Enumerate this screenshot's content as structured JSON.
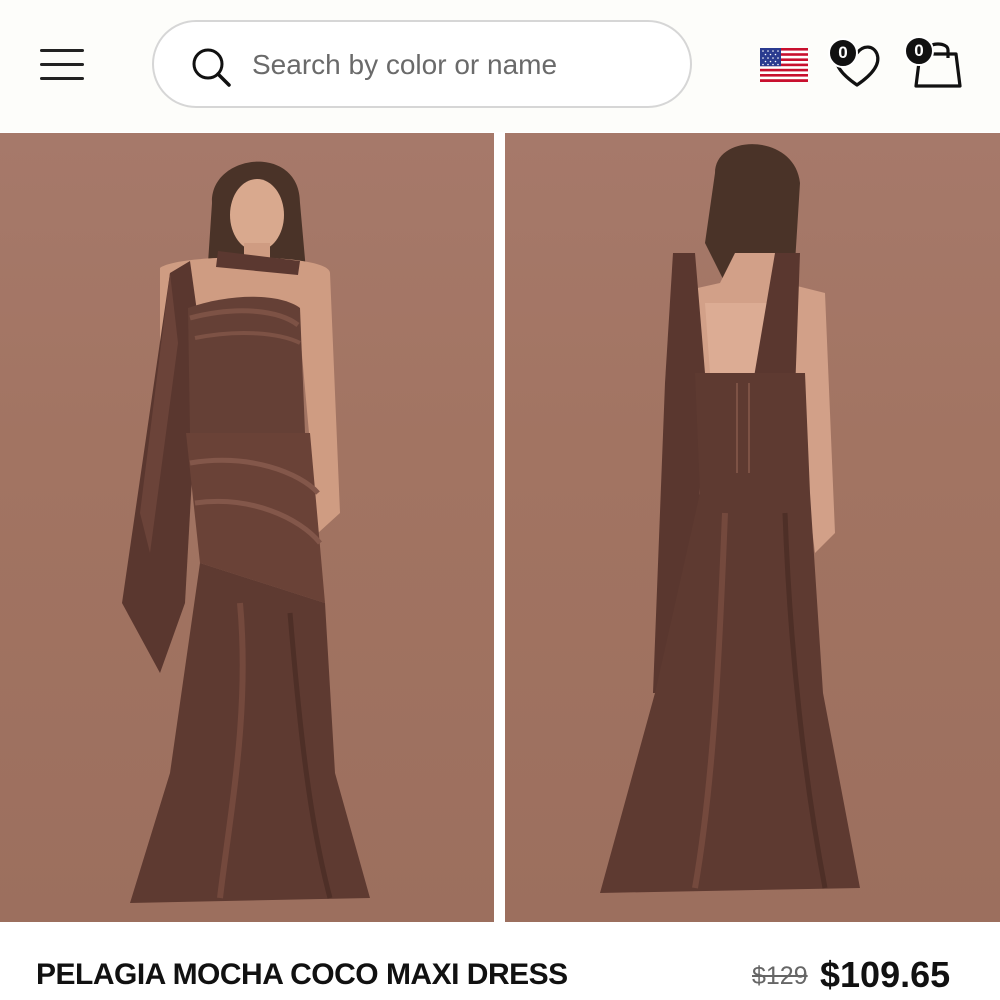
{
  "header": {
    "menu_icon": "hamburger-menu-icon",
    "search": {
      "placeholder": "Search by color or name",
      "value": ""
    },
    "region_flag": "us-flag-icon",
    "wishlist_count": "0",
    "cart_count": "0"
  },
  "gallery": {
    "images": [
      {
        "view": "front",
        "alt": "Model wearing mocha satin strapless maxi dress with scarf, front view"
      },
      {
        "view": "back",
        "alt": "Model wearing mocha satin maxi dress with scarf, back view"
      }
    ],
    "background_color": "#a3766a",
    "dress_color": "#5e3a31"
  },
  "product": {
    "name": "PELAGIA MOCHA COCO MAXI DRESS",
    "original_price": "$129",
    "sale_price": "$109.65"
  }
}
